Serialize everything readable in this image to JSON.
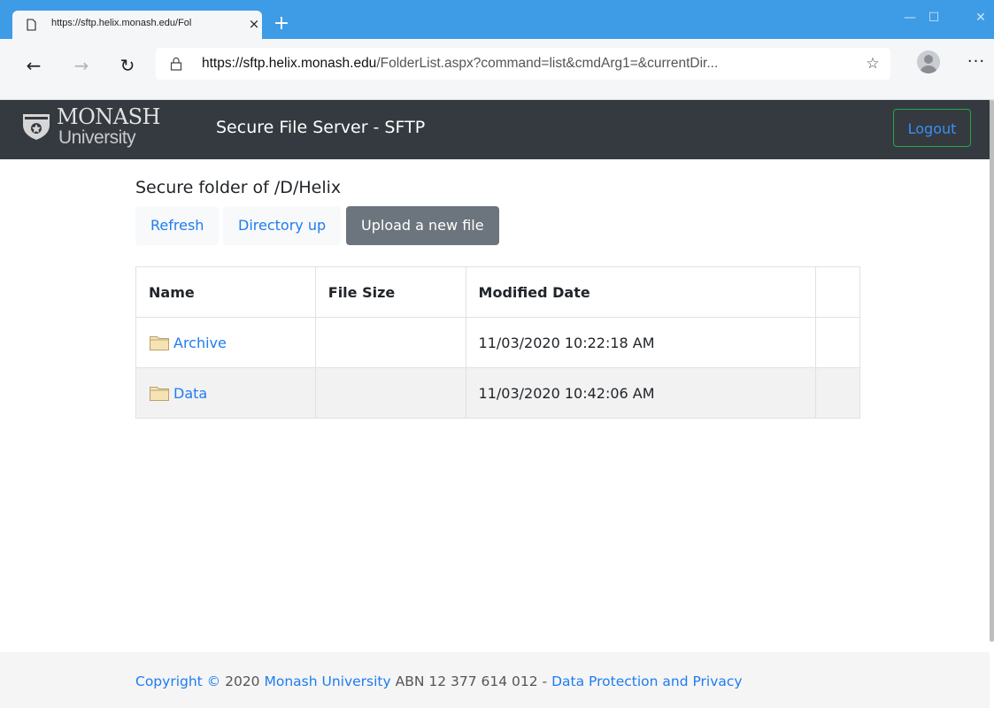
{
  "browser": {
    "tab_title": "https://sftp.helix.monash.edu/Fol",
    "tab_close": "×",
    "new_tab": "+",
    "url_host": "https://sftp.helix.monash.edu",
    "url_path": "/FolderList.aspx?command=list&cmdArg1=&currentDir...",
    "back": "←",
    "forward": "→",
    "refresh": "↻",
    "minimize": "—",
    "maximize": "☐",
    "close": "✕",
    "star": "☆",
    "more": "···"
  },
  "site": {
    "brand_line1": "MONASH",
    "brand_line2": "University",
    "title": "Secure File Server - SFTP",
    "logout_label": "Logout"
  },
  "main": {
    "heading": "Secure folder of /D/Helix",
    "refresh_label": "Refresh",
    "dir_up_label": "Directory up",
    "upload_label": "Upload a new file",
    "columns": [
      "Name",
      "File Size",
      "Modified Date",
      ""
    ],
    "rows": [
      {
        "name": "Archive",
        "size": "",
        "modified": "11/03/2020 10:22:18 AM"
      },
      {
        "name": "Data",
        "size": "",
        "modified": "11/03/2020 10:42:06 AM"
      }
    ]
  },
  "footer": {
    "copyright_link": "Copyright ©",
    "year": " 2020 ",
    "org_link": "Monash University",
    "abn": " ABN 12 377 614 012 - ",
    "privacy_link": "Data Protection and Privacy"
  },
  "colors": {
    "tabstrip": "#3e9be6",
    "navbar": "#343a40",
    "link": "#1f7cf0",
    "logout_border": "#28a745",
    "upload_button": "#6c757d"
  }
}
